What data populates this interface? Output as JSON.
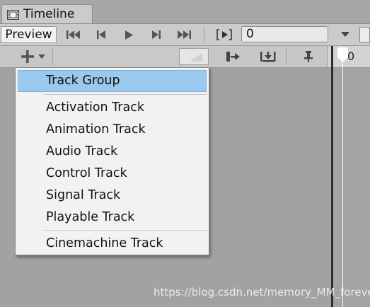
{
  "window": {
    "tab_label": "Timeline"
  },
  "toolbar": {
    "preview_label": "Preview",
    "frame_value": "0"
  },
  "ruler": {
    "start_label": "0"
  },
  "add_menu": {
    "items": [
      {
        "label": "Track Group",
        "selected": true
      },
      {
        "label": "Activation Track"
      },
      {
        "label": "Animation Track"
      },
      {
        "label": "Audio Track"
      },
      {
        "label": "Control Track"
      },
      {
        "label": "Signal Track"
      },
      {
        "label": "Playable Track"
      },
      {
        "label": "Cinemachine Track"
      }
    ]
  },
  "watermark": "https://blog.csdn.net/memory_MM_forever",
  "colors": {
    "selection": "#99c9ef",
    "toolbar": "#cbcbcb",
    "background": "#a3a3a3"
  }
}
